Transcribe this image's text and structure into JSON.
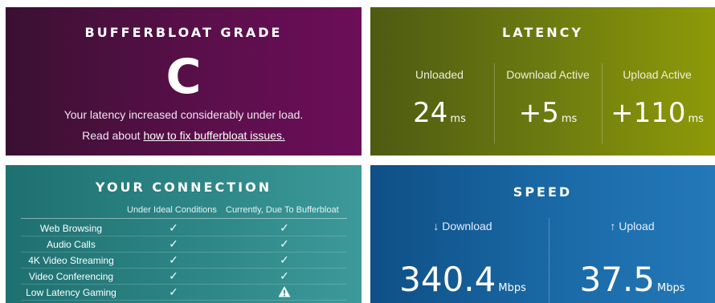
{
  "grade": {
    "title": "BUFFERBLOAT GRADE",
    "letter": "C",
    "message": "Your latency increased considerably under load.",
    "read_prefix": "Read about ",
    "read_link": "how to fix bufferbloat issues."
  },
  "latency": {
    "title": "LATENCY",
    "columns": [
      {
        "label": "Unloaded",
        "value": "24",
        "unit": "ms"
      },
      {
        "label": "Download Active",
        "value": "+5",
        "unit": "ms"
      },
      {
        "label": "Upload Active",
        "value": "+110",
        "unit": "ms"
      }
    ]
  },
  "connection": {
    "title": "YOUR CONNECTION",
    "col_ideal": "Under Ideal Conditions",
    "col_current": "Currently, Due To Bufferbloat",
    "rows": [
      {
        "name": "Web Browsing",
        "ideal": "✓",
        "current": "✓"
      },
      {
        "name": "Audio Calls",
        "ideal": "✓",
        "current": "✓"
      },
      {
        "name": "4K Video Streaming",
        "ideal": "✓",
        "current": "✓"
      },
      {
        "name": "Video Conferencing",
        "ideal": "✓",
        "current": "✓"
      },
      {
        "name": "Low Latency Gaming",
        "ideal": "✓",
        "current": "warning-icon"
      }
    ]
  },
  "speed": {
    "title": "SPEED",
    "download_label": "↓ Download",
    "download_value": "340.4",
    "download_unit": "Mbps",
    "upload_label": "↑ Upload",
    "upload_value": "37.5",
    "upload_unit": "Mbps"
  }
}
